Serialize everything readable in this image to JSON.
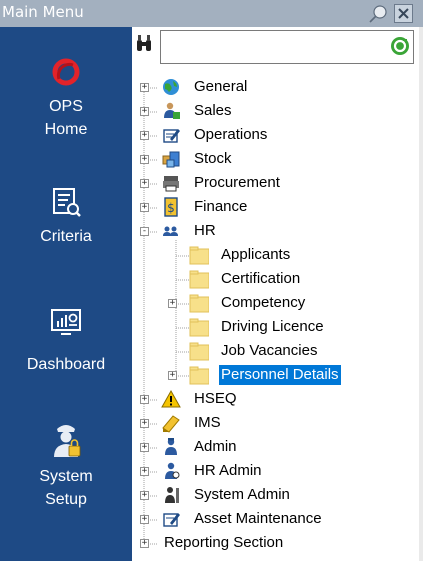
{
  "window": {
    "title": "Main Menu"
  },
  "sidebar": {
    "items": [
      {
        "label_lines": [
          "OPS",
          "Home"
        ],
        "icon": "ops-logo-icon"
      },
      {
        "label_lines": [
          "Criteria"
        ],
        "icon": "criteria-icon"
      },
      {
        "label_lines": [
          "Dashboard"
        ],
        "icon": "dashboard-icon"
      },
      {
        "label_lines": [
          "System",
          "Setup"
        ],
        "icon": "system-setup-icon"
      }
    ]
  },
  "search": {
    "value": "",
    "placeholder": ""
  },
  "tree": {
    "nodes": [
      {
        "label": "General",
        "icon": "globe-icon",
        "expander": "+"
      },
      {
        "label": "Sales",
        "icon": "sales-person-icon",
        "expander": "+"
      },
      {
        "label": "Operations",
        "icon": "operations-icon",
        "expander": "+"
      },
      {
        "label": "Stock",
        "icon": "stock-boxes-icon",
        "expander": "+"
      },
      {
        "label": "Procurement",
        "icon": "procurement-icon",
        "expander": "+"
      },
      {
        "label": "Finance",
        "icon": "finance-icon",
        "expander": "+"
      },
      {
        "label": "HR",
        "icon": "hr-people-icon",
        "expander": "-",
        "children": [
          {
            "label": "Applicants",
            "icon": "folder-icon",
            "expander": ""
          },
          {
            "label": "Certification",
            "icon": "folder-icon",
            "expander": ""
          },
          {
            "label": "Competency",
            "icon": "folder-icon",
            "expander": "+"
          },
          {
            "label": "Driving Licence",
            "icon": "folder-icon",
            "expander": ""
          },
          {
            "label": "Job Vacancies",
            "icon": "folder-icon",
            "expander": ""
          },
          {
            "label": "Personnel Details",
            "icon": "folder-icon",
            "expander": "+",
            "selected": true
          }
        ]
      },
      {
        "label": "HSEQ",
        "icon": "warning-icon",
        "expander": "+"
      },
      {
        "label": "IMS",
        "icon": "ims-pencil-icon",
        "expander": "+"
      },
      {
        "label": "Admin",
        "icon": "admin-person-icon",
        "expander": "+"
      },
      {
        "label": "HR Admin",
        "icon": "hr-admin-icon",
        "expander": "+"
      },
      {
        "label": "System Admin",
        "icon": "system-admin-icon",
        "expander": "+"
      },
      {
        "label": "Asset Maintenance",
        "icon": "asset-maintenance-icon",
        "expander": "+"
      },
      {
        "label": "Reporting Section",
        "icon": "",
        "expander": "+"
      }
    ]
  },
  "colors": {
    "sidebar": "#1e4a85",
    "selection": "#0078d7",
    "titlebar": "#a3b0bf"
  }
}
